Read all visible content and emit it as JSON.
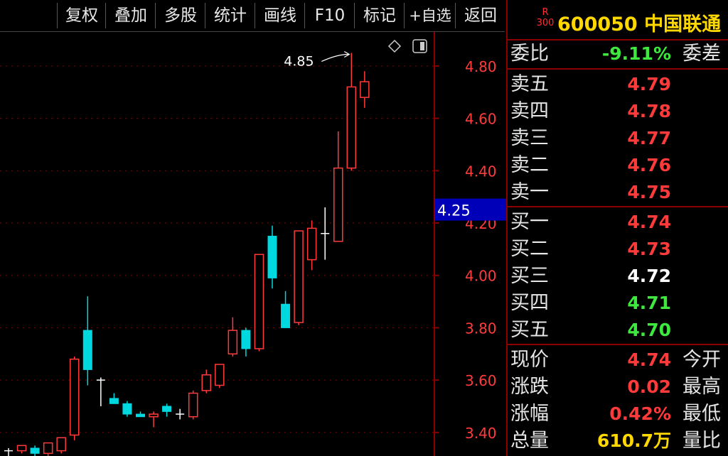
{
  "toolbar": {
    "items": [
      "复权",
      "叠加",
      "多股",
      "统计",
      "画线",
      "F10",
      "标记",
      "+自选",
      "返回"
    ]
  },
  "stock": {
    "badge_top": "R",
    "badge_bottom": "300",
    "code": "600050",
    "name": "中国联通"
  },
  "commission": {
    "label": "委比",
    "value": "-9.11%",
    "tail": "委差"
  },
  "asks": [
    {
      "label": "卖五",
      "price": "4.79"
    },
    {
      "label": "卖四",
      "price": "4.78"
    },
    {
      "label": "卖三",
      "price": "4.77"
    },
    {
      "label": "卖二",
      "price": "4.76"
    },
    {
      "label": "卖一",
      "price": "4.75"
    }
  ],
  "bids": [
    {
      "label": "买一",
      "price": "4.74"
    },
    {
      "label": "买二",
      "price": "4.73"
    },
    {
      "label": "买三",
      "price": "4.72"
    },
    {
      "label": "买四",
      "price": "4.71"
    },
    {
      "label": "买五",
      "price": "4.70"
    }
  ],
  "stats": [
    {
      "label": "现价",
      "value": "4.74",
      "tail": "今开"
    },
    {
      "label": "涨跌",
      "value": "0.02",
      "tail": "最高"
    },
    {
      "label": "涨幅",
      "value": "0.42%",
      "tail": "最低"
    },
    {
      "label": "总量",
      "value": "610.7万",
      "tail": "量比"
    }
  ],
  "colors": {
    "up": "#ff3a3a",
    "down": "#00d8e0",
    "neutral": "#ffffff",
    "grid": "#8b0000",
    "highlight": "#0000b8"
  },
  "chart_data": {
    "type": "candlestick",
    "y_ticks": [
      "4.80",
      "4.60",
      "4.40",
      "4.20",
      "4.00",
      "3.80",
      "3.60",
      "3.40"
    ],
    "ylim": [
      3.31,
      4.93
    ],
    "current_price_label": "4.25",
    "current_price_value": 4.25,
    "high_annotation": "4.85",
    "high_value": 4.85,
    "candles": [
      {
        "o": 3.33,
        "h": 3.34,
        "l": 3.31,
        "c": 3.33
      },
      {
        "o": 3.33,
        "h": 3.35,
        "l": 3.32,
        "c": 3.35
      },
      {
        "o": 3.34,
        "h": 3.35,
        "l": 3.31,
        "c": 3.32
      },
      {
        "o": 3.32,
        "h": 3.36,
        "l": 3.3,
        "c": 3.36
      },
      {
        "o": 3.33,
        "h": 3.38,
        "l": 3.32,
        "c": 3.38
      },
      {
        "o": 3.39,
        "h": 3.69,
        "l": 3.37,
        "c": 3.68
      },
      {
        "o": 3.79,
        "h": 3.92,
        "l": 3.58,
        "c": 3.64
      },
      {
        "o": 3.6,
        "h": 3.61,
        "l": 3.5,
        "c": 3.6
      },
      {
        "o": 3.53,
        "h": 3.55,
        "l": 3.51,
        "c": 3.51
      },
      {
        "o": 3.51,
        "h": 3.52,
        "l": 3.46,
        "c": 3.47
      },
      {
        "o": 3.47,
        "h": 3.48,
        "l": 3.46,
        "c": 3.46
      },
      {
        "o": 3.46,
        "h": 3.48,
        "l": 3.42,
        "c": 3.47
      },
      {
        "o": 3.5,
        "h": 3.51,
        "l": 3.46,
        "c": 3.48
      },
      {
        "o": 3.47,
        "h": 3.49,
        "l": 3.45,
        "c": 3.47
      },
      {
        "o": 3.46,
        "h": 3.56,
        "l": 3.45,
        "c": 3.55
      },
      {
        "o": 3.56,
        "h": 3.64,
        "l": 3.55,
        "c": 3.62
      },
      {
        "o": 3.58,
        "h": 3.66,
        "l": 3.57,
        "c": 3.66
      },
      {
        "o": 3.7,
        "h": 3.84,
        "l": 3.69,
        "c": 3.79
      },
      {
        "o": 3.79,
        "h": 3.8,
        "l": 3.69,
        "c": 3.72
      },
      {
        "o": 3.72,
        "h": 4.08,
        "l": 3.71,
        "c": 4.08
      },
      {
        "o": 4.15,
        "h": 4.19,
        "l": 3.95,
        "c": 3.99
      },
      {
        "o": 3.89,
        "h": 3.94,
        "l": 3.8,
        "c": 3.8
      },
      {
        "o": 3.82,
        "h": 4.17,
        "l": 3.81,
        "c": 4.17
      },
      {
        "o": 4.06,
        "h": 4.21,
        "l": 4.02,
        "c": 4.18
      },
      {
        "o": 4.16,
        "h": 4.26,
        "l": 4.06,
        "c": 4.16
      },
      {
        "o": 4.13,
        "h": 4.55,
        "l": 4.13,
        "c": 4.41
      },
      {
        "o": 4.41,
        "h": 4.85,
        "l": 4.4,
        "c": 4.72
      },
      {
        "o": 4.68,
        "h": 4.78,
        "l": 4.64,
        "c": 4.74
      }
    ]
  }
}
